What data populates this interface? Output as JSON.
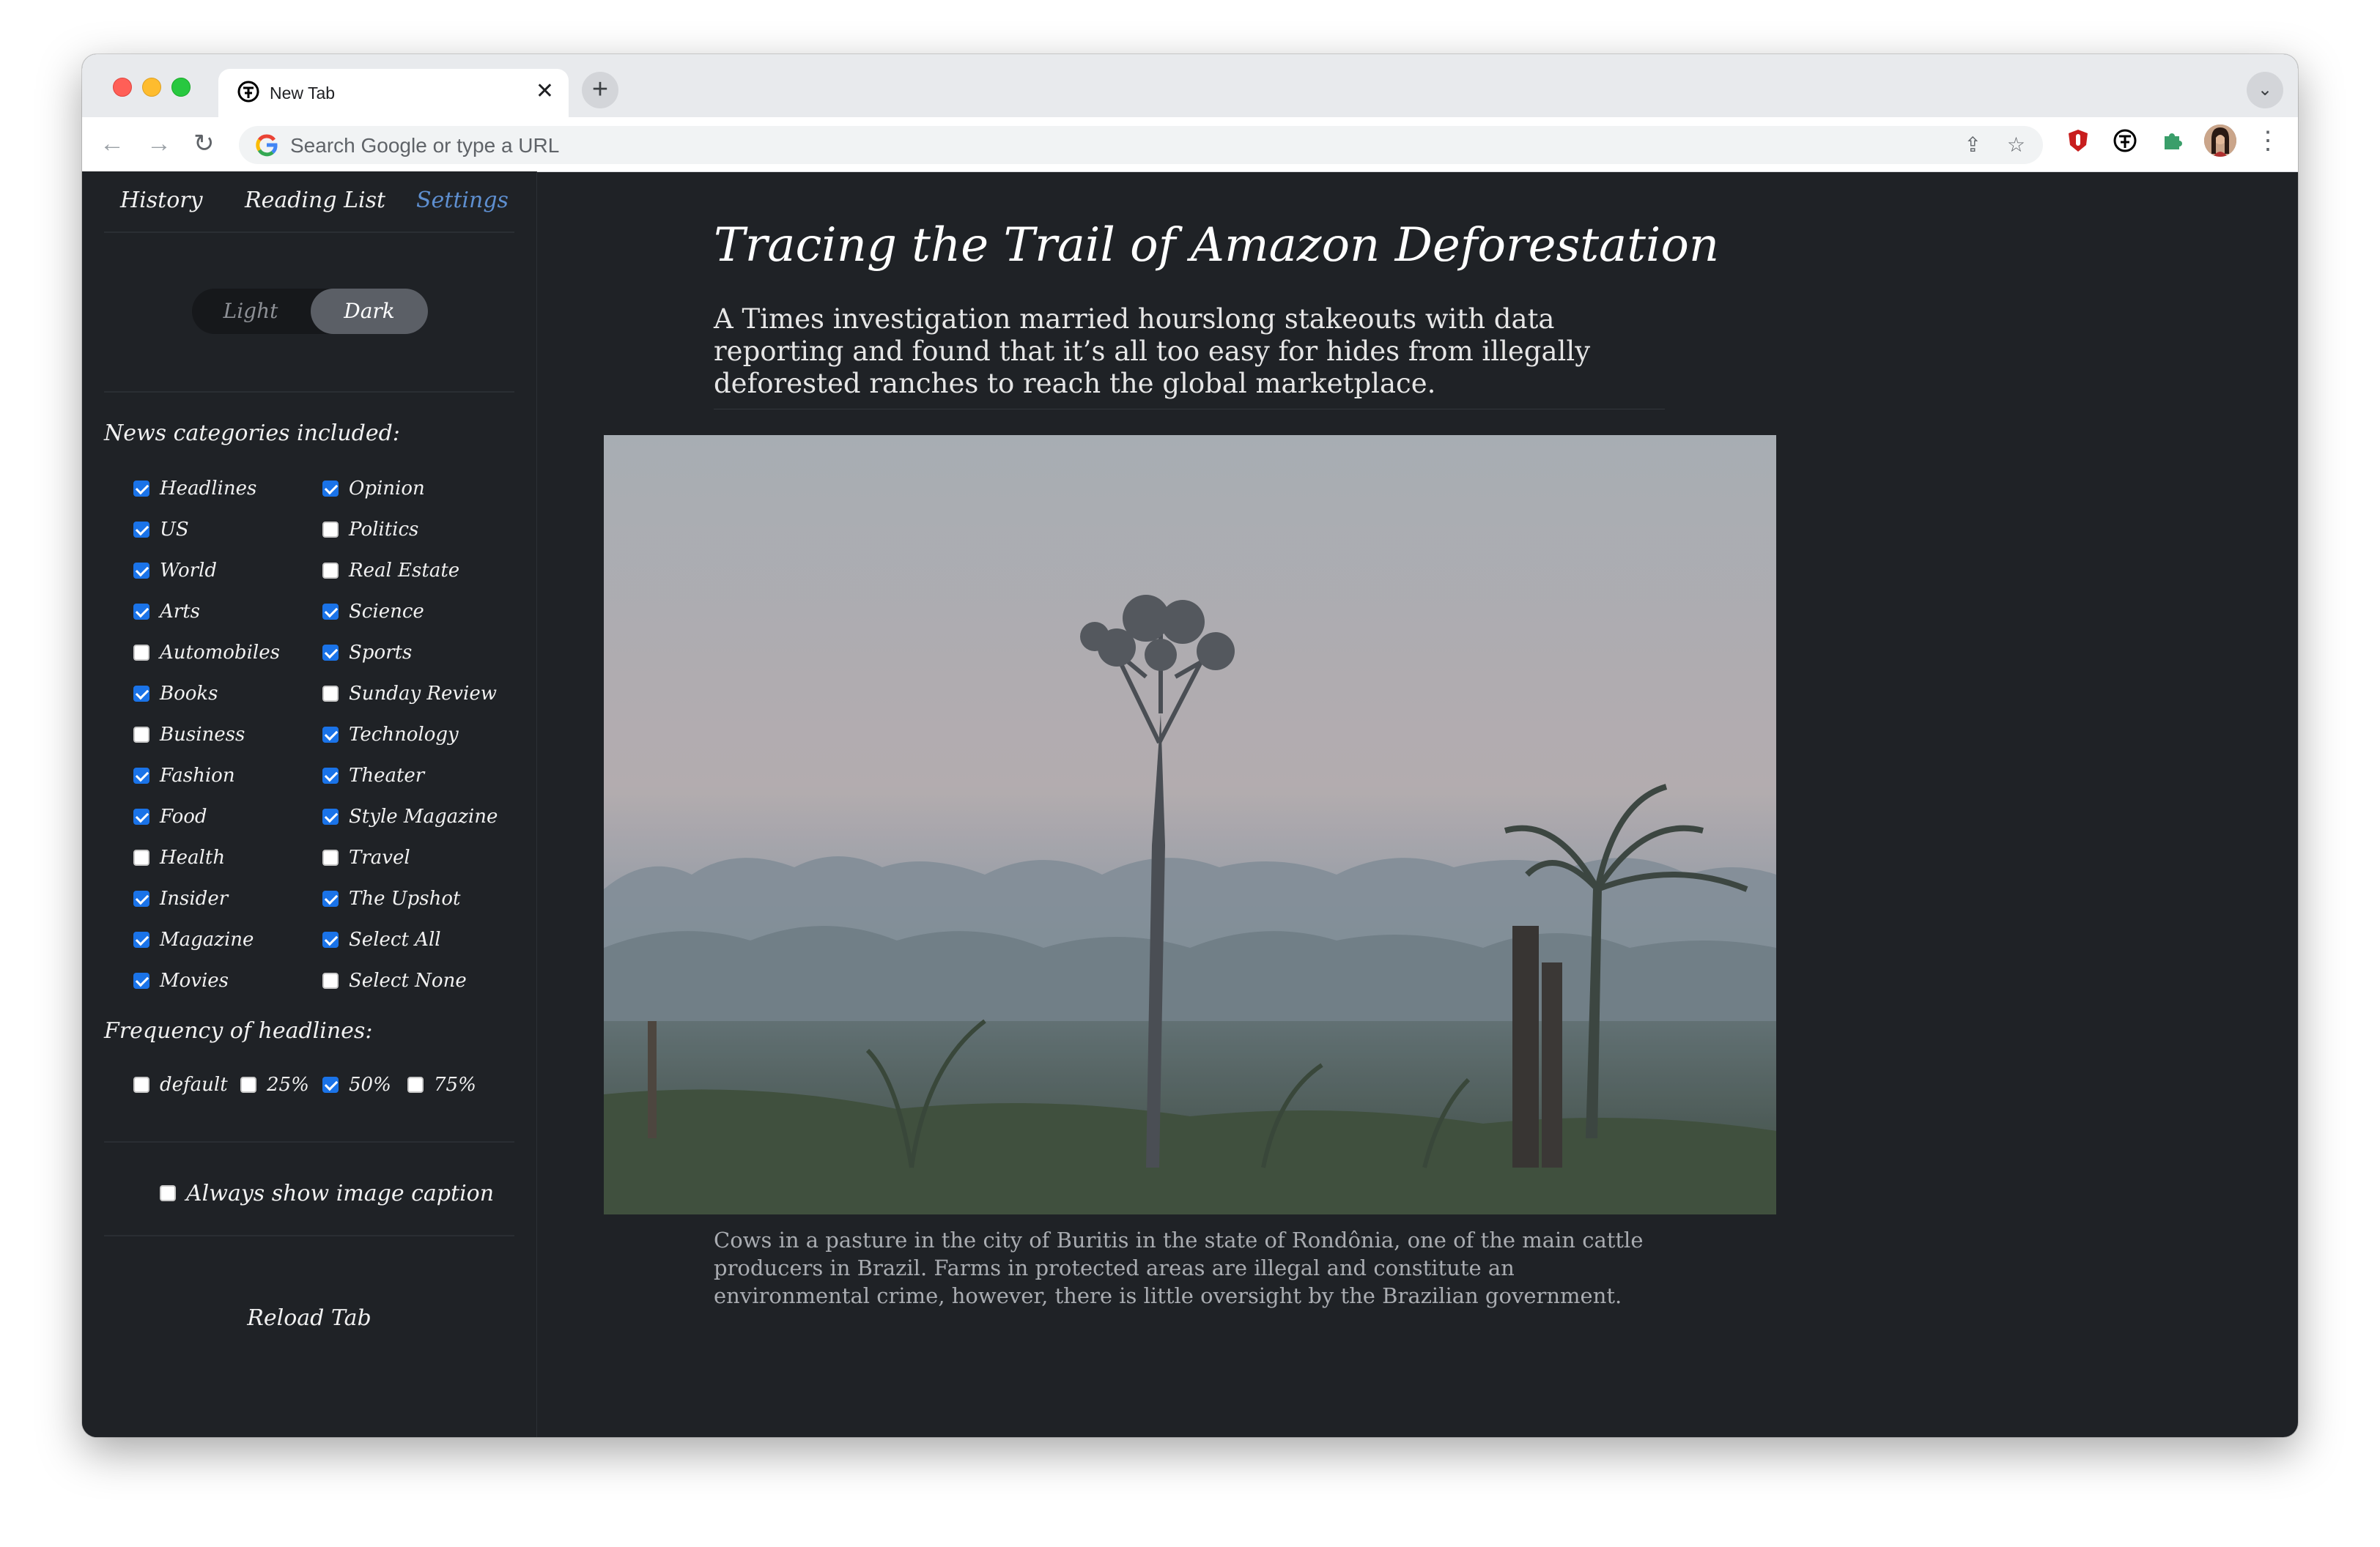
{
  "browser": {
    "tab_title": "New Tab",
    "omnibox_placeholder": "Search Google or type a URL"
  },
  "sidebar": {
    "nav": [
      "History",
      "Reading List",
      "Settings"
    ],
    "theme_toggle": {
      "light": "Light",
      "dark": "Dark",
      "selected": "Dark"
    },
    "categories_heading": "News categories included:",
    "categories_left": [
      {
        "label": "Headlines",
        "checked": true
      },
      {
        "label": "US",
        "checked": true
      },
      {
        "label": "World",
        "checked": true
      },
      {
        "label": "Arts",
        "checked": true
      },
      {
        "label": "Automobiles",
        "checked": false
      },
      {
        "label": "Books",
        "checked": true
      },
      {
        "label": "Business",
        "checked": false
      },
      {
        "label": "Fashion",
        "checked": true
      },
      {
        "label": "Food",
        "checked": true
      },
      {
        "label": "Health",
        "checked": false
      },
      {
        "label": "Insider",
        "checked": true
      },
      {
        "label": "Magazine",
        "checked": true
      },
      {
        "label": "Movies",
        "checked": true
      }
    ],
    "categories_right": [
      {
        "label": "Opinion",
        "checked": true
      },
      {
        "label": "Politics",
        "checked": false
      },
      {
        "label": "Real Estate",
        "checked": false
      },
      {
        "label": "Science",
        "checked": true
      },
      {
        "label": "Sports",
        "checked": true
      },
      {
        "label": "Sunday Review",
        "checked": false
      },
      {
        "label": "Technology",
        "checked": true
      },
      {
        "label": "Theater",
        "checked": true
      },
      {
        "label": "Style Magazine",
        "checked": true
      },
      {
        "label": "Travel",
        "checked": false
      },
      {
        "label": "The Upshot",
        "checked": true
      },
      {
        "label": "Select All",
        "checked": true
      },
      {
        "label": "Select None",
        "checked": false
      }
    ],
    "frequency_heading": "Frequency of headlines:",
    "frequency_options": [
      {
        "label": "default",
        "checked": false
      },
      {
        "label": "25%",
        "checked": false
      },
      {
        "label": "50%",
        "checked": true
      },
      {
        "label": "75%",
        "checked": false
      }
    ],
    "caption_option": {
      "label": "Always show image caption",
      "checked": false
    },
    "reload_label": "Reload Tab"
  },
  "article": {
    "title": "Tracing the Trail of Amazon Deforestation",
    "subtitle": "A Times investigation married hourslong stakeouts with data reporting and found that it’s all too easy for hides from illegally deforested ranches to reach the global marketplace.",
    "caption": "Cows in a pasture in the city of Buritis in the state of Rondônia, one of the main cattle producers in Brazil. Farms in protected areas are illegal and constitute an environmental crime, however, there is little oversight by the Brazilian government."
  },
  "colors": {
    "page_bg": "#1f2226",
    "accent_link": "#5e8fd0",
    "checkbox_on": "#1a73e8"
  }
}
